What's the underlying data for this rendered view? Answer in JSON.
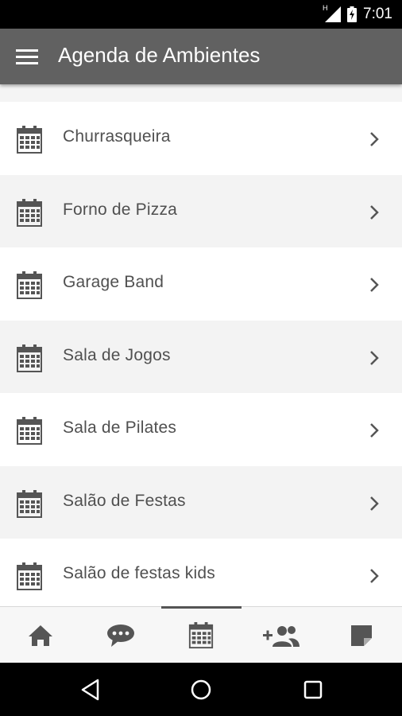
{
  "status_bar": {
    "time": "7:01",
    "network_label": "H",
    "icons": [
      "signal-icon",
      "battery-charging-icon"
    ]
  },
  "app_bar": {
    "title": "Agenda de Ambientes",
    "menu_icon": "menu-icon"
  },
  "list": {
    "items": [
      {
        "label": "Churrasqueira",
        "icon": "calendar-icon"
      },
      {
        "label": "Forno de Pizza",
        "icon": "calendar-icon"
      },
      {
        "label": "Garage Band",
        "icon": "calendar-icon"
      },
      {
        "label": "Sala de Jogos",
        "icon": "calendar-icon"
      },
      {
        "label": "Sala de Pilates",
        "icon": "calendar-icon"
      },
      {
        "label": "Salão de Festas",
        "icon": "calendar-icon"
      },
      {
        "label": "Salão de festas kids",
        "icon": "calendar-icon"
      }
    ]
  },
  "bottom_nav": {
    "items": [
      {
        "icon": "home-icon",
        "active": false
      },
      {
        "icon": "chat-icon",
        "active": false
      },
      {
        "icon": "calendar-icon",
        "active": true
      },
      {
        "icon": "add-person-icon",
        "active": false
      },
      {
        "icon": "note-icon",
        "active": false
      }
    ]
  },
  "system_nav": {
    "icons": [
      "back-icon",
      "home-circle-icon",
      "recents-icon"
    ]
  },
  "colors": {
    "app_bar": "#616161",
    "list_text": "#505050",
    "icon_gray": "#555555",
    "status_bar": "#000000"
  }
}
